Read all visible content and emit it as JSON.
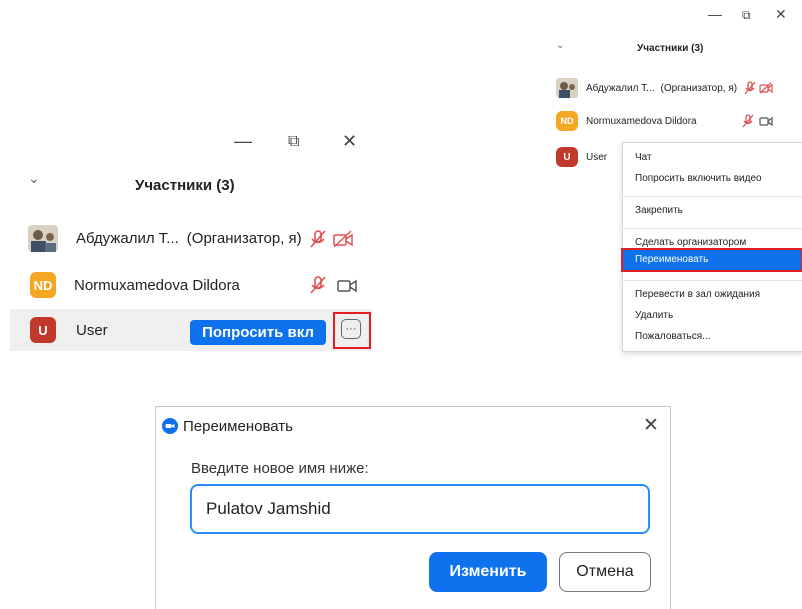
{
  "large_panel": {
    "title": "Участники (3)",
    "participants": [
      {
        "name": "Абдужалил Т...",
        "role": "(Организатор, я)"
      },
      {
        "name": "Normuxamedova Dildora",
        "initials": "ND",
        "avatar_color": "#f5a623"
      },
      {
        "name": "User",
        "initials": "U",
        "avatar_color": "#c0392b"
      }
    ],
    "ask_button_label": "Попросить вкл",
    "more_icon": "more-dots-icon"
  },
  "small_panel": {
    "title": "Участники (3)",
    "participants": [
      {
        "name": "Абдужалил Т...",
        "role": "(Организатор, я)"
      },
      {
        "name": "Normuxamedova Dildora",
        "initials": "ND"
      },
      {
        "name": "User",
        "initials": "U"
      }
    ]
  },
  "context_menu": {
    "items": [
      "Чат",
      "Попросить включить видео",
      "Закрепить",
      "Сделать организатором",
      "Переименовать",
      "Перевести в зал ожидания",
      "Удалить",
      "Пожаловаться..."
    ],
    "highlighted_index": 4
  },
  "dialog": {
    "title": "Переименовать",
    "prompt": "Введите новое имя ниже:",
    "input_value": "Pulatov Jamshid",
    "confirm_label": "Изменить",
    "cancel_label": "Отмена"
  },
  "colors": {
    "accent": "#0e72ed",
    "highlight_box": "#e02020",
    "muted_red": "#e05050"
  }
}
